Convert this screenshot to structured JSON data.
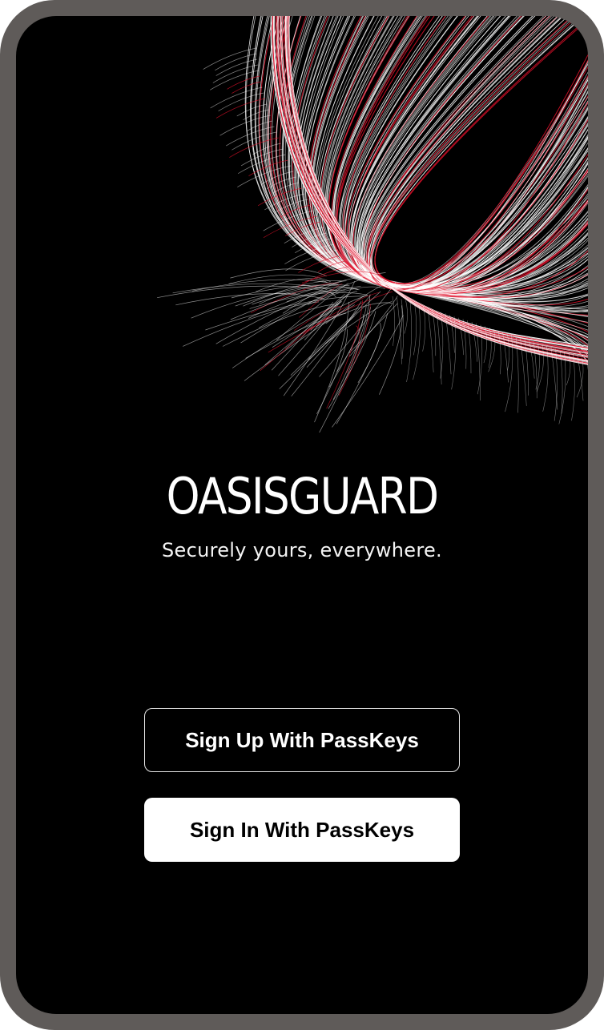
{
  "app": {
    "name": "OASISGUARD",
    "tagline": "Securely yours, everywhere."
  },
  "actions": {
    "sign_up_label": "Sign Up With PassKeys",
    "sign_in_label": "Sign In With PassKeys"
  },
  "theme": {
    "background": "#000000",
    "frame": "#5f5b59",
    "line_white": "#ffffff",
    "line_red": "#e0102a",
    "primary_button_bg": "#ffffff",
    "primary_button_text": "#000000"
  },
  "decoration": {
    "icon": "radiating-lines-burst"
  }
}
